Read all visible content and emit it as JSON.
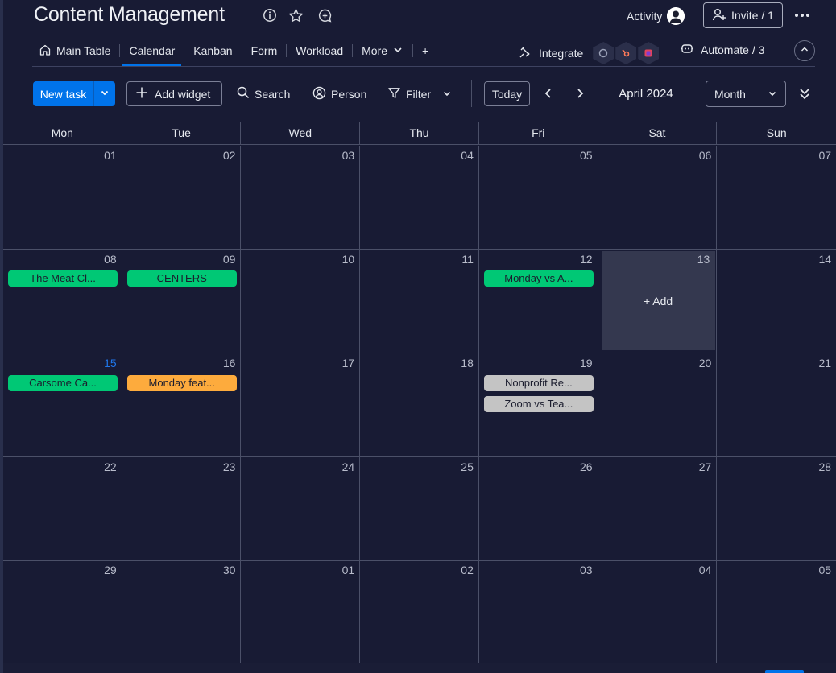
{
  "header": {
    "title": "Content Management",
    "activity_label": "Activity",
    "invite_label": "Invite / 1"
  },
  "tabs": [
    {
      "label": "Main Table",
      "icon": "home-icon"
    },
    {
      "label": "Calendar"
    },
    {
      "label": "Kanban"
    },
    {
      "label": "Form"
    },
    {
      "label": "Workload"
    },
    {
      "label": "More"
    },
    {
      "label": "+"
    }
  ],
  "integrations": {
    "integrate_label": "Integrate",
    "automate_label": "Automate / 3"
  },
  "toolbar": {
    "new_task": "New task",
    "add_widget": "Add widget",
    "search": "Search",
    "person": "Person",
    "filter": "Filter",
    "today": "Today",
    "month_label": "April 2024",
    "view_select": "Month"
  },
  "calendar": {
    "weekdays": [
      "Mon",
      "Tue",
      "Wed",
      "Thu",
      "Fri",
      "Sat",
      "Sun"
    ],
    "weeks": [
      [
        {
          "num": "01",
          "events": []
        },
        {
          "num": "02",
          "events": []
        },
        {
          "num": "03",
          "events": []
        },
        {
          "num": "04",
          "events": []
        },
        {
          "num": "05",
          "events": []
        },
        {
          "num": "06",
          "events": []
        },
        {
          "num": "07",
          "events": []
        }
      ],
      [
        {
          "num": "08",
          "events": [
            {
              "label": "The Meat Cl...",
              "color": "#00c875"
            }
          ]
        },
        {
          "num": "09",
          "events": [
            {
              "label": "CENTERS",
              "color": "#00c875"
            }
          ]
        },
        {
          "num": "10",
          "events": []
        },
        {
          "num": "11",
          "events": []
        },
        {
          "num": "12",
          "events": [
            {
              "label": "Monday vs A...",
              "color": "#00c875"
            }
          ]
        },
        {
          "num": "13",
          "events": [],
          "add_label": "+ Add"
        },
        {
          "num": "14",
          "events": []
        }
      ],
      [
        {
          "num": "15",
          "events": [
            {
              "label": "Carsome Ca...",
              "color": "#00c875"
            }
          ],
          "is_today": true
        },
        {
          "num": "16",
          "events": [
            {
              "label": "Monday feat...",
              "color": "#fdab3d"
            }
          ]
        },
        {
          "num": "17",
          "events": []
        },
        {
          "num": "18",
          "events": []
        },
        {
          "num": "19",
          "events": [
            {
              "label": "Nonprofit Re...",
              "color": "#c4c4c4"
            },
            {
              "label": "Zoom vs Tea...",
              "color": "#c4c4c4"
            }
          ]
        },
        {
          "num": "20",
          "events": []
        },
        {
          "num": "21",
          "events": []
        }
      ],
      [
        {
          "num": "22",
          "events": []
        },
        {
          "num": "23",
          "events": []
        },
        {
          "num": "24",
          "events": []
        },
        {
          "num": "25",
          "events": []
        },
        {
          "num": "26",
          "events": []
        },
        {
          "num": "27",
          "events": []
        },
        {
          "num": "28",
          "events": []
        }
      ],
      [
        {
          "num": "29",
          "events": []
        },
        {
          "num": "30",
          "events": []
        },
        {
          "num": "01",
          "events": []
        },
        {
          "num": "02",
          "events": []
        },
        {
          "num": "03",
          "events": []
        },
        {
          "num": "04",
          "events": []
        },
        {
          "num": "05",
          "events": []
        }
      ]
    ]
  },
  "colors": {
    "accent": "#0073ea",
    "background": "#181b34",
    "done_green": "#00c875",
    "working_orange": "#fdab3d",
    "neutral_gray": "#c4c4c4"
  }
}
